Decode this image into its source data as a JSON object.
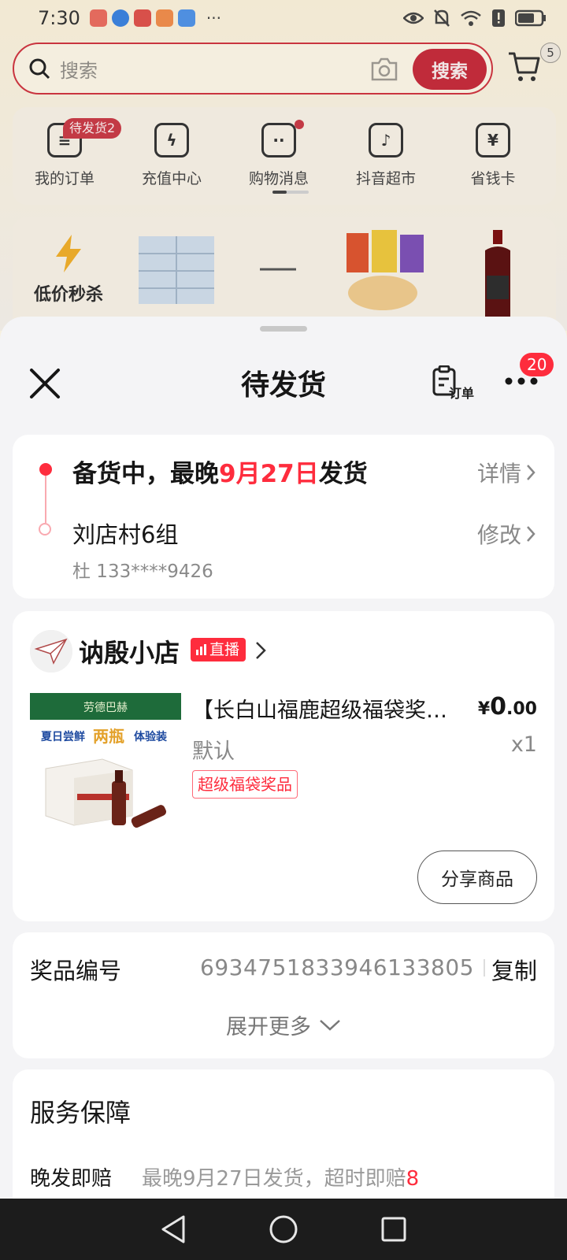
{
  "status_bar": {
    "time": "7:30",
    "more": "···"
  },
  "search": {
    "placeholder": "搜索",
    "button_label": "搜索",
    "cart_count": "5"
  },
  "quick_menu": {
    "items": [
      {
        "label": "我的订单",
        "badge": "待发货2",
        "icon": "order-list-icon"
      },
      {
        "label": "充值中心",
        "icon": "lightning-icon"
      },
      {
        "label": "购物消息",
        "icon": "message-icon"
      },
      {
        "label": "抖音超市",
        "icon": "basket-icon"
      },
      {
        "label": "省钱卡",
        "icon": "yen-card-icon"
      }
    ]
  },
  "promo": {
    "flash_sale_label": "低价秒杀"
  },
  "sheet": {
    "title": "待发货",
    "orders_label": "订单",
    "more_badge": "20"
  },
  "shipping": {
    "prefix": "备货中，最晚",
    "date": "9月27日",
    "suffix": "发货",
    "detail_link": "详情",
    "address": "刘店村6组",
    "modify_link": "修改",
    "contact": "杜 133****9426"
  },
  "shop": {
    "name": "讷殷小店",
    "live_tag": "直播"
  },
  "product": {
    "title": "【长白山福鹿超级福袋奖品】",
    "price_symbol": "¥",
    "price_int": "0",
    "price_dec": ".00",
    "spec": "默认",
    "qty": "x1",
    "tag": "超级福袋奖品",
    "share_button": "分享商品",
    "image_texts": {
      "brand": "劳德巴赫",
      "tagline_a": "夏日尝鲜",
      "tagline_b": "两瓶",
      "tagline_c": "体验装"
    }
  },
  "prize": {
    "label": "奖品编号",
    "number": "6934751833946133805",
    "copy": "复制",
    "expand": "展开更多"
  },
  "service": {
    "title": "服务保障",
    "row_label": "晚发即赔",
    "row_text": "最晚9月27日发货，超时即赔",
    "row_highlight": "8"
  },
  "colors": {
    "accent": "#fe2c3d",
    "search_border": "#c9343f"
  }
}
